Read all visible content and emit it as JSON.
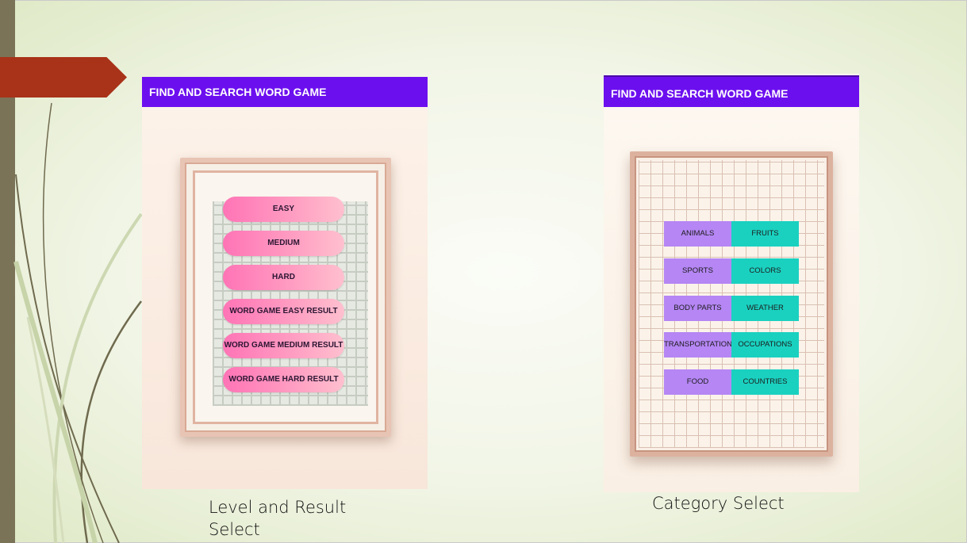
{
  "slide": {
    "colors": {
      "left_bar": "#7b7357",
      "arrow_tab": "#a83319",
      "appbar": "#6c0fef",
      "level_button": "#ff74b6",
      "category_purple": "#b586f4",
      "category_teal": "#1ad1c0"
    }
  },
  "left_screen": {
    "appbar_title": "FIND AND SEARCH WORD GAME",
    "buttons": [
      {
        "label": "EASY"
      },
      {
        "label": "MEDIUM"
      },
      {
        "label": "HARD"
      },
      {
        "label": "WORD GAME EASY RESULT"
      },
      {
        "label": "WORD GAME MEDIUM RESULT"
      },
      {
        "label": "WORD GAME HARD RESULT"
      }
    ],
    "caption": "Level and Result\nSelect"
  },
  "right_screen": {
    "appbar_title": "FIND AND SEARCH WORD GAME",
    "categories": [
      {
        "left": "ANIMALS",
        "right": "FRUITS"
      },
      {
        "left": "SPORTS",
        "right": "COLORS"
      },
      {
        "left": "BODY PARTS",
        "right": "WEATHER"
      },
      {
        "left": "TRANSPORTATION",
        "right": "OCCUPATIONS"
      },
      {
        "left": "FOOD",
        "right": "COUNTRIES"
      }
    ],
    "caption": "Category Select"
  }
}
